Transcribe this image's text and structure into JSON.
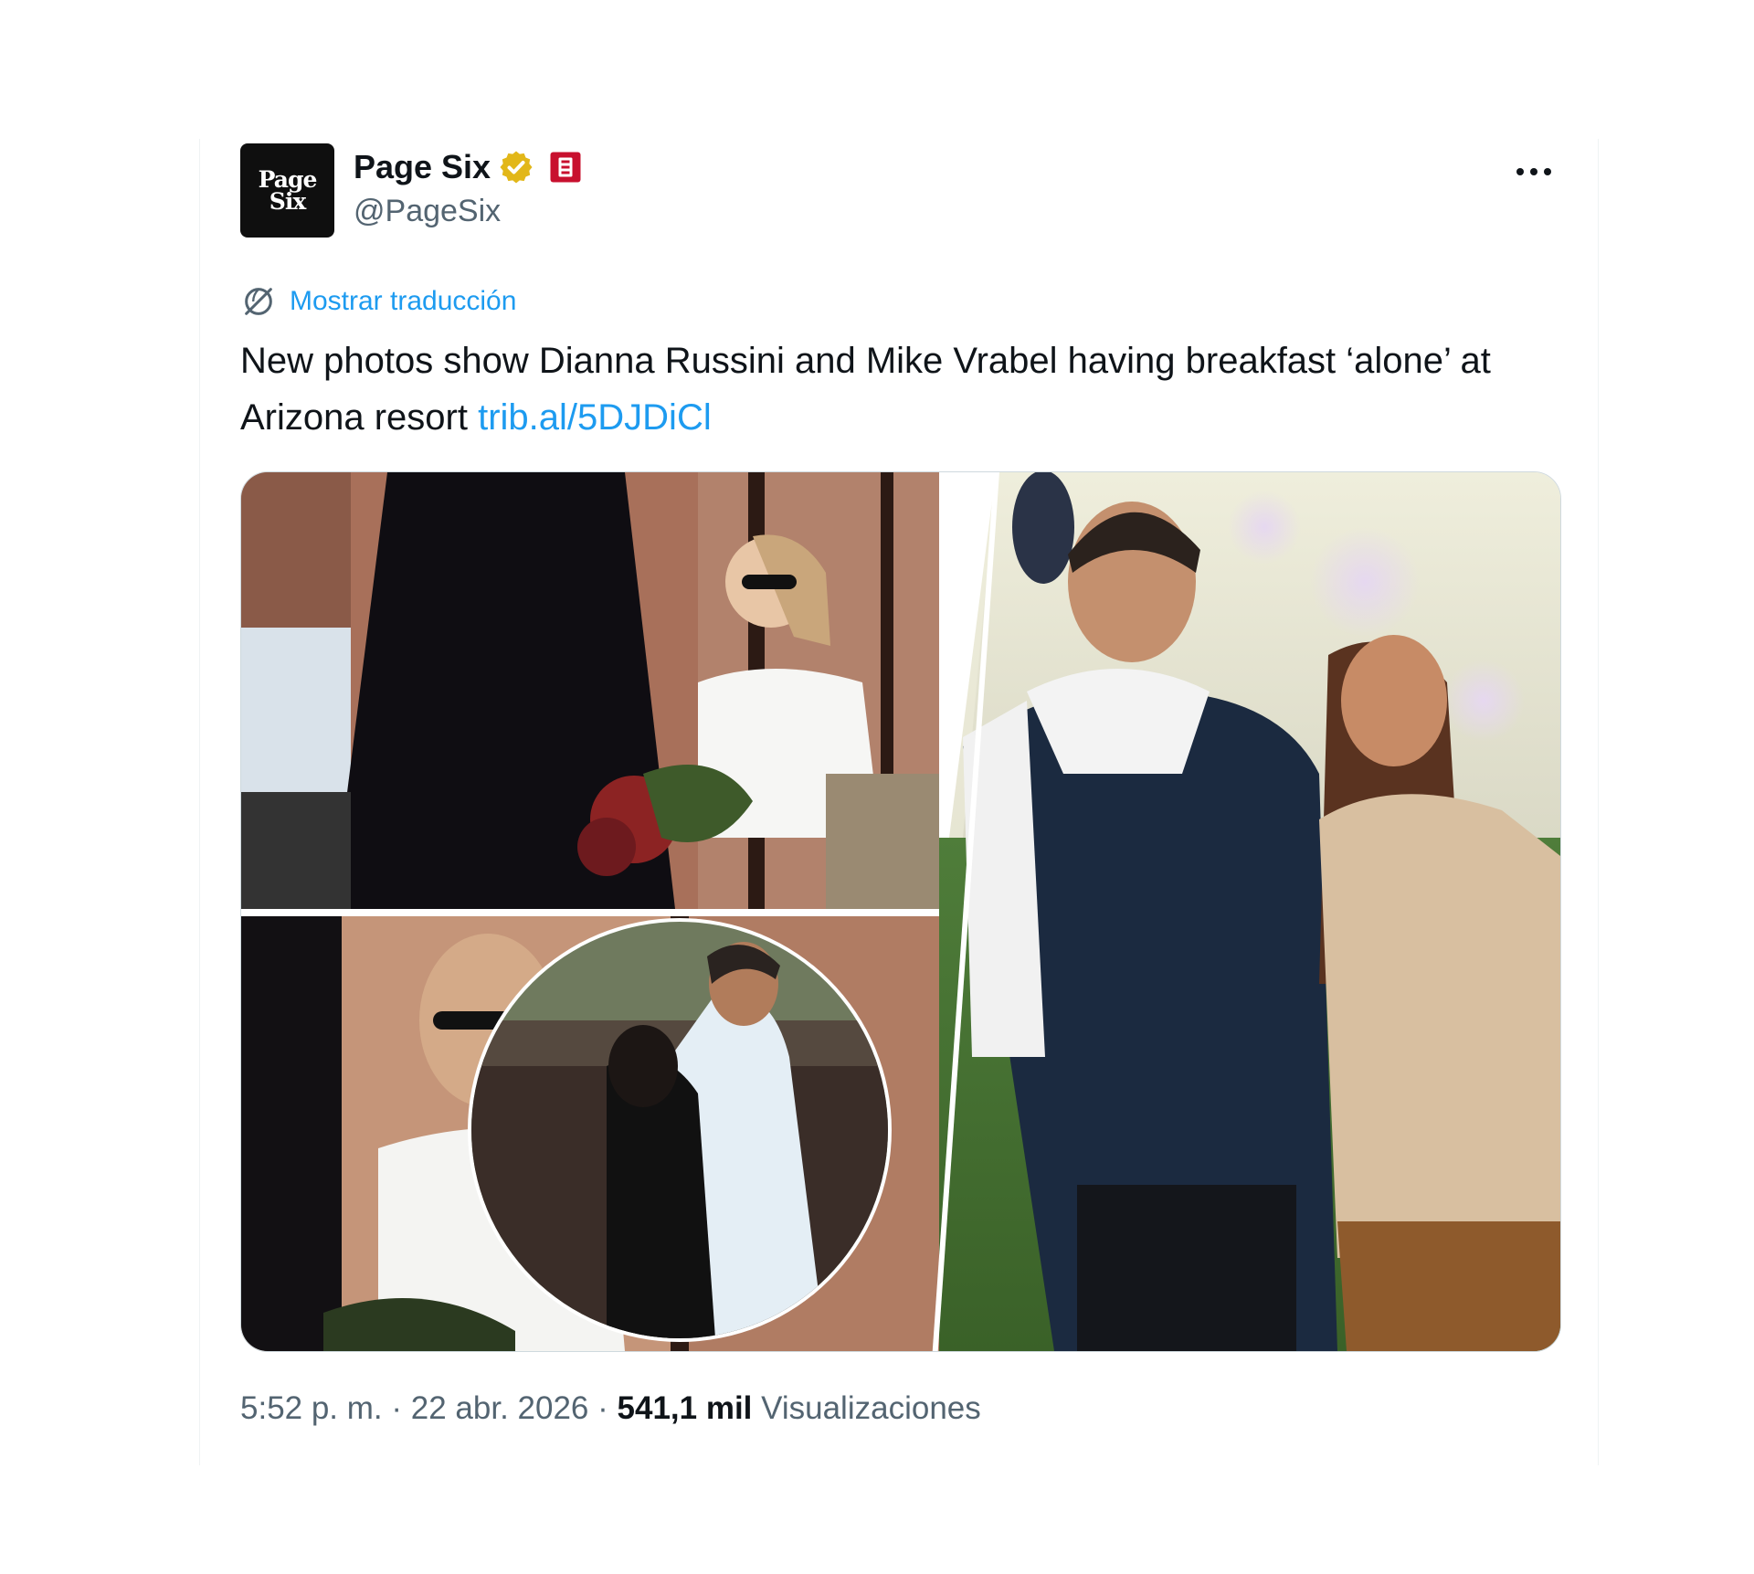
{
  "tweet": {
    "author": {
      "avatar_text_line1": "Page",
      "avatar_text_line2": "Six",
      "display_name": "Page Six",
      "handle": "@PageSix"
    },
    "translate_label": "Mostrar traducción",
    "text": "New photos show Dianna Russini and Mike Vrabel having breakfast ‘alone’ at Arizona resort ",
    "link_text": "trib.al/5DJDiCl",
    "time": "5:52 p. m.",
    "separator": "·",
    "date": "22 abr. 2026",
    "views_count": "541,1 mil",
    "views_label": "Visualizaciones"
  },
  "icons": {
    "verified": "verified-gold-badge-icon",
    "affiliate": "affiliate-badge-icon",
    "more": "more-options-icon",
    "translate": "globe-icon"
  },
  "colors": {
    "link": "#1d9bf0",
    "verified_gold": "#e2b719",
    "affiliate_red": "#c8102e",
    "text_primary": "#0f1419",
    "text_secondary": "#536471"
  }
}
